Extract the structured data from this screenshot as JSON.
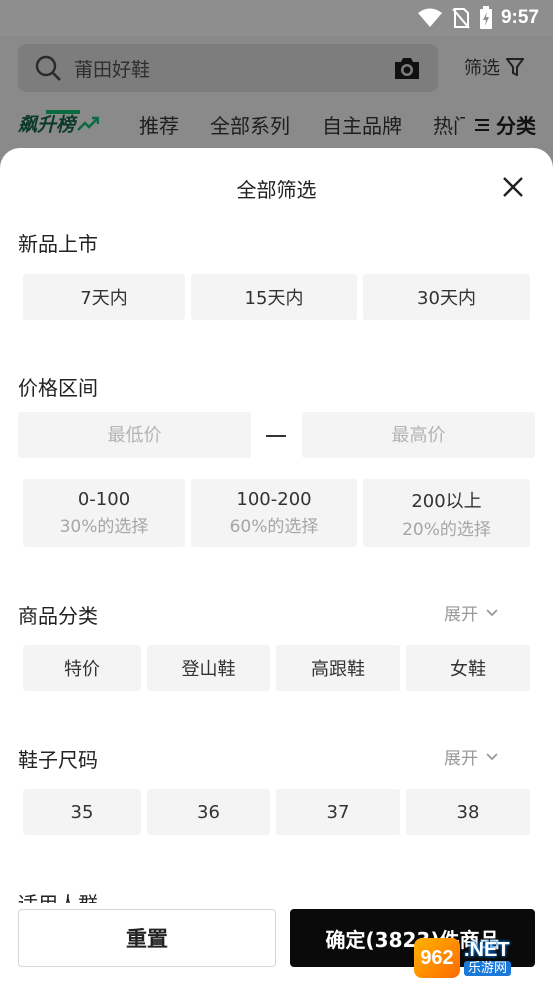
{
  "status_bar": {
    "time": "9:57"
  },
  "header": {
    "search_placeholder": "莆田好鞋",
    "filter_label": "筛选",
    "tabs": [
      "飙升榜",
      "推荐",
      "全部系列",
      "自主品牌",
      "热门"
    ],
    "category_label": "分类"
  },
  "sheet": {
    "title": "全部筛选",
    "new_arrivals": {
      "title": "新品上市",
      "options": [
        "7天内",
        "15天内",
        "30天内"
      ]
    },
    "price": {
      "title": "价格区间",
      "min_placeholder": "最低价",
      "max_placeholder": "最高价",
      "ranges": [
        {
          "label": "0-100",
          "sub": "30%的选择"
        },
        {
          "label": "100-200",
          "sub": "60%的选择"
        },
        {
          "label": "200以上",
          "sub": "20%的选择"
        }
      ]
    },
    "category": {
      "title": "商品分类",
      "expand_label": "展开",
      "options": [
        "特价",
        "登山鞋",
        "高跟鞋",
        "女鞋"
      ]
    },
    "size": {
      "title": "鞋子尺码",
      "expand_label": "展开",
      "options": [
        "35",
        "36",
        "37",
        "38"
      ]
    },
    "audience": {
      "title": "适用人群"
    },
    "footer": {
      "reset_label": "重置",
      "confirm_label": "确定(3823)件商品"
    }
  },
  "watermark": {
    "logo": "962",
    "net": ".NET",
    "cn": "乐游网"
  },
  "colors": {
    "accent": "#0b6a42",
    "confirm_bg": "#0a0a0a",
    "chip_bg": "#f4f4f4",
    "overlay": "#8a8a8a"
  }
}
